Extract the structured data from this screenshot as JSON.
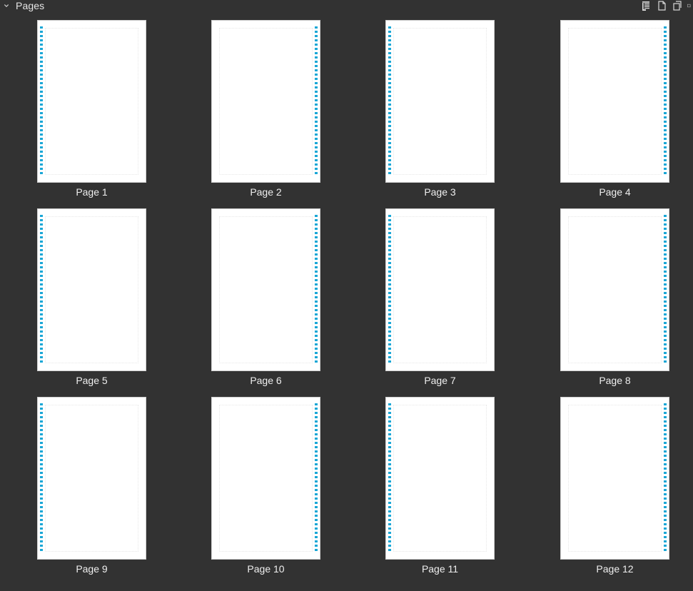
{
  "panel": {
    "title": "Pages",
    "icons": {
      "chevron": "chevron-down-icon",
      "actions": [
        {
          "name": "page-master-icon"
        },
        {
          "name": "new-page-icon"
        },
        {
          "name": "duplicate-page-icon"
        },
        {
          "name": "more-options-icon"
        }
      ]
    }
  },
  "pages": [
    {
      "label": "Page 1",
      "spine": "left"
    },
    {
      "label": "Page 2",
      "spine": "right"
    },
    {
      "label": "Page 3",
      "spine": "left"
    },
    {
      "label": "Page 4",
      "spine": "right"
    },
    {
      "label": "Page 5",
      "spine": "left"
    },
    {
      "label": "Page 6",
      "spine": "right"
    },
    {
      "label": "Page 7",
      "spine": "left"
    },
    {
      "label": "Page 8",
      "spine": "right"
    },
    {
      "label": "Page 9",
      "spine": "left"
    },
    {
      "label": "Page 10",
      "spine": "right"
    },
    {
      "label": "Page 11",
      "spine": "left"
    },
    {
      "label": "Page 12",
      "spine": "right"
    }
  ],
  "colors": {
    "panel_background": "#323232",
    "thumb_background": "#ffffff",
    "spine_accent": "#1aa7d6",
    "label_text": "#efefef"
  }
}
